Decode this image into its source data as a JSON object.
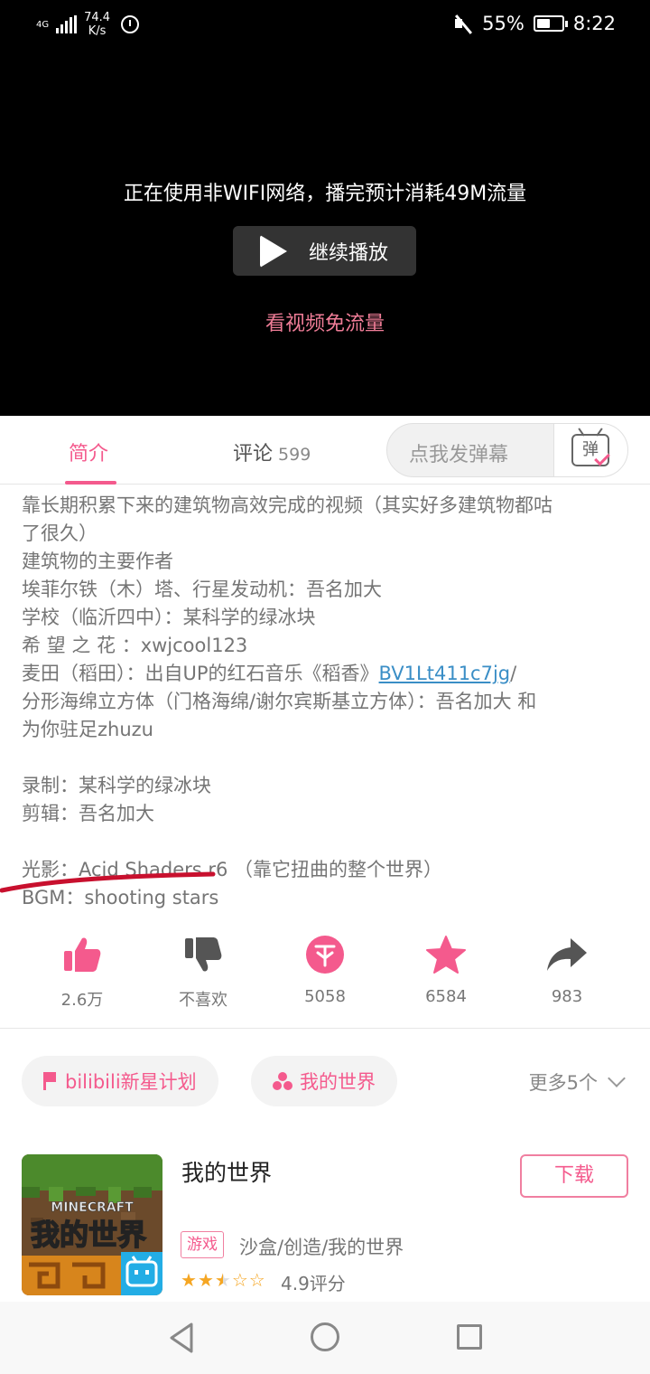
{
  "status_bar": {
    "network": "4G",
    "net_speed_value": "74.4",
    "net_speed_unit": "K/s",
    "battery_percent": "55%",
    "battery_level": 0.55,
    "time": "8:22"
  },
  "video": {
    "network_warning": "正在使用非WIFI网络，播完预计消耗49M流量",
    "continue_label": "继续播放",
    "free_data_link": "看视频免流量"
  },
  "tabs": {
    "intro_label": "简介",
    "comments_label": "评论",
    "comments_count": "599",
    "danmaku_placeholder": "点我发弹幕",
    "danmaku_icon_char": "弹"
  },
  "description": {
    "lines": [
      "靠长期积累下来的建筑物高效完成的视频（其实好多建筑物都咕",
      "了很久）",
      "建筑物的主要作者",
      "埃菲尔铁（木）塔、行星发动机：吾名加大",
      "学校（临沂四中）：某科学的绿冰块",
      "希 望 之 花 ：xwjcool123"
    ],
    "maitian_prefix": "麦田（稻田）：出自UP的红石音乐《稻香》",
    "maitian_link": "BV1Lt411c7jg",
    "maitian_suffix": "/",
    "lines2": [
      "分形海绵立方体（门格海绵/谢尔宾斯基立方体）：吾名加大 和",
      "为你驻足zhuzu"
    ],
    "lines3": [
      "录制：某科学的绿冰块",
      "剪辑：吾名加大"
    ],
    "lines4": [
      "光影：Acid Shaders r6 （靠它扭曲的整个世界）",
      "BGM：shooting stars"
    ]
  },
  "actions": [
    {
      "icon": "thumbs-up-icon",
      "label": "2.6万"
    },
    {
      "icon": "thumbs-down-icon",
      "label": "不喜欢"
    },
    {
      "icon": "coin-icon",
      "label": "5058"
    },
    {
      "icon": "star-icon",
      "label": "6584"
    },
    {
      "icon": "share-icon",
      "label": "983"
    }
  ],
  "tags": {
    "tag1": "bilibili新星计划",
    "tag2": "我的世界",
    "more": "更多5个"
  },
  "game": {
    "title": "我的世界",
    "download_label": "下载",
    "badge": "游戏",
    "categories": "沙盒/创造/我的世界",
    "rating_text": "4.9评分",
    "rating_stars": 2.5,
    "cover_logo": "MINECRAFT",
    "cover_title": "我的世界"
  },
  "colors": {
    "accent": "#f45a8d",
    "link": "#3a8ec6",
    "star": "#f5a623"
  }
}
